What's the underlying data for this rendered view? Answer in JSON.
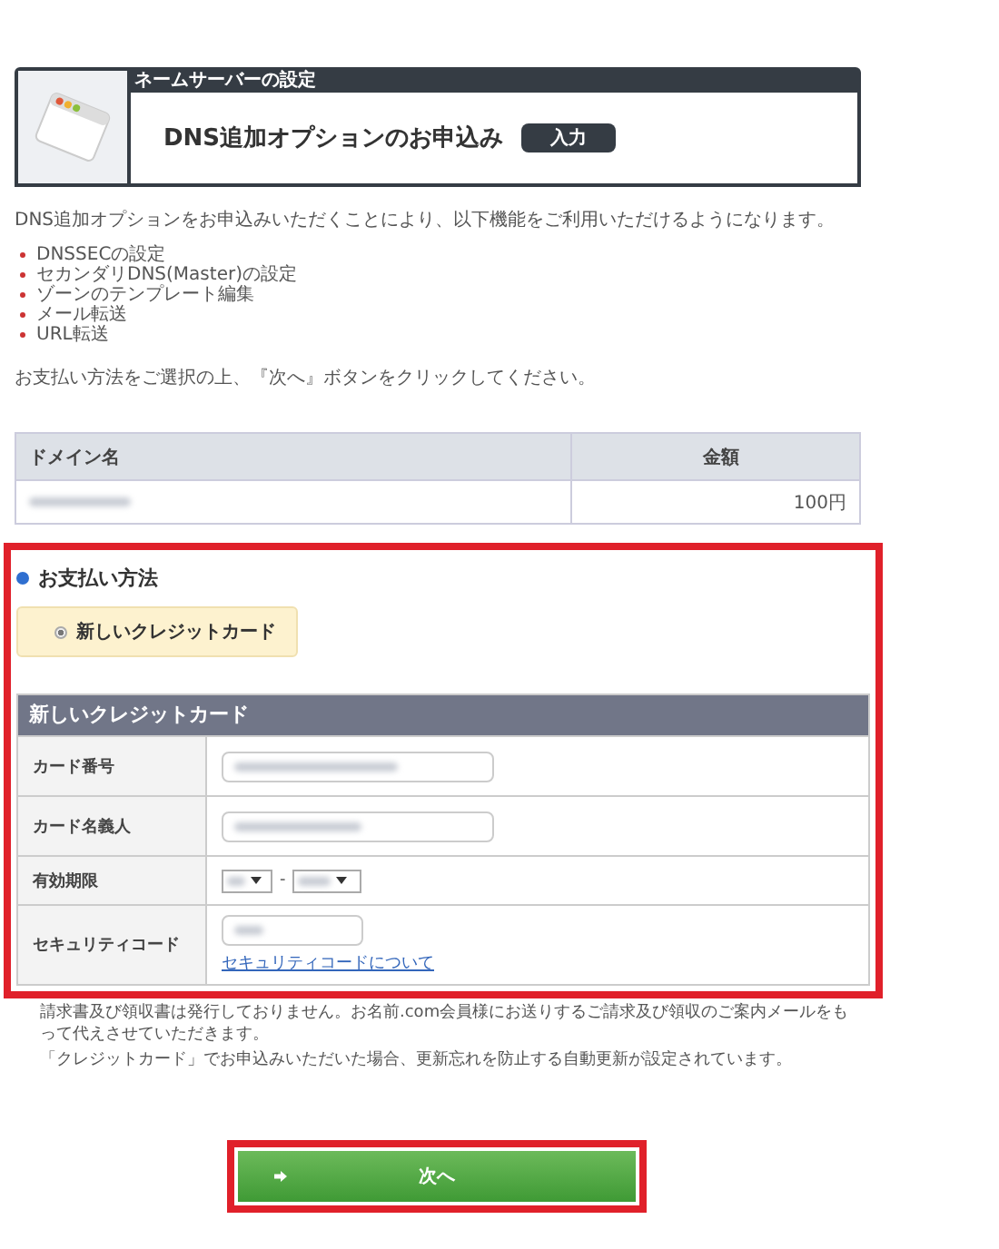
{
  "header": {
    "category": "ネームサーバーの設定",
    "title": "DNS追加オプションのお申込み",
    "step": "入力"
  },
  "intro": "DNS追加オプションをお申込みいただくことにより、以下機能をご利用いただけるようになります。",
  "features": [
    "DNSSECの設定",
    "セカンダリDNS(Master)の設定",
    "ゾーンのテンプレート編集",
    "メール転送",
    "URL転送"
  ],
  "instruction": "お支払い方法をご選択の上、『次へ』ボタンをクリックしてください。",
  "domain_table": {
    "columns": [
      "ドメイン名",
      "金額"
    ],
    "rows": [
      {
        "price": "100円"
      }
    ]
  },
  "payment": {
    "heading": "お支払い方法",
    "options": [
      {
        "label": "新しいクレジットカード",
        "selected": true
      }
    ]
  },
  "card_form": {
    "title": "新しいクレジットカード",
    "rows": [
      {
        "kind": "text",
        "label": "カード番号"
      },
      {
        "kind": "text",
        "label": "カード名義人"
      },
      {
        "kind": "expiry",
        "label": "有効期限",
        "separator": "-"
      },
      {
        "kind": "security",
        "label": "セキュリティコード",
        "link": "セキュリティコードについて"
      }
    ]
  },
  "notes": [
    "請求書及び領収書は発行しておりません。お名前.com会員様にお送りするご請求及び領収のご案内メールをもって代えさせていただきます。",
    "「クレジットカード」でお申込みいただいた場合、更新忘れを防止する自動更新が設定されています。"
  ],
  "next_button": "次へ"
}
